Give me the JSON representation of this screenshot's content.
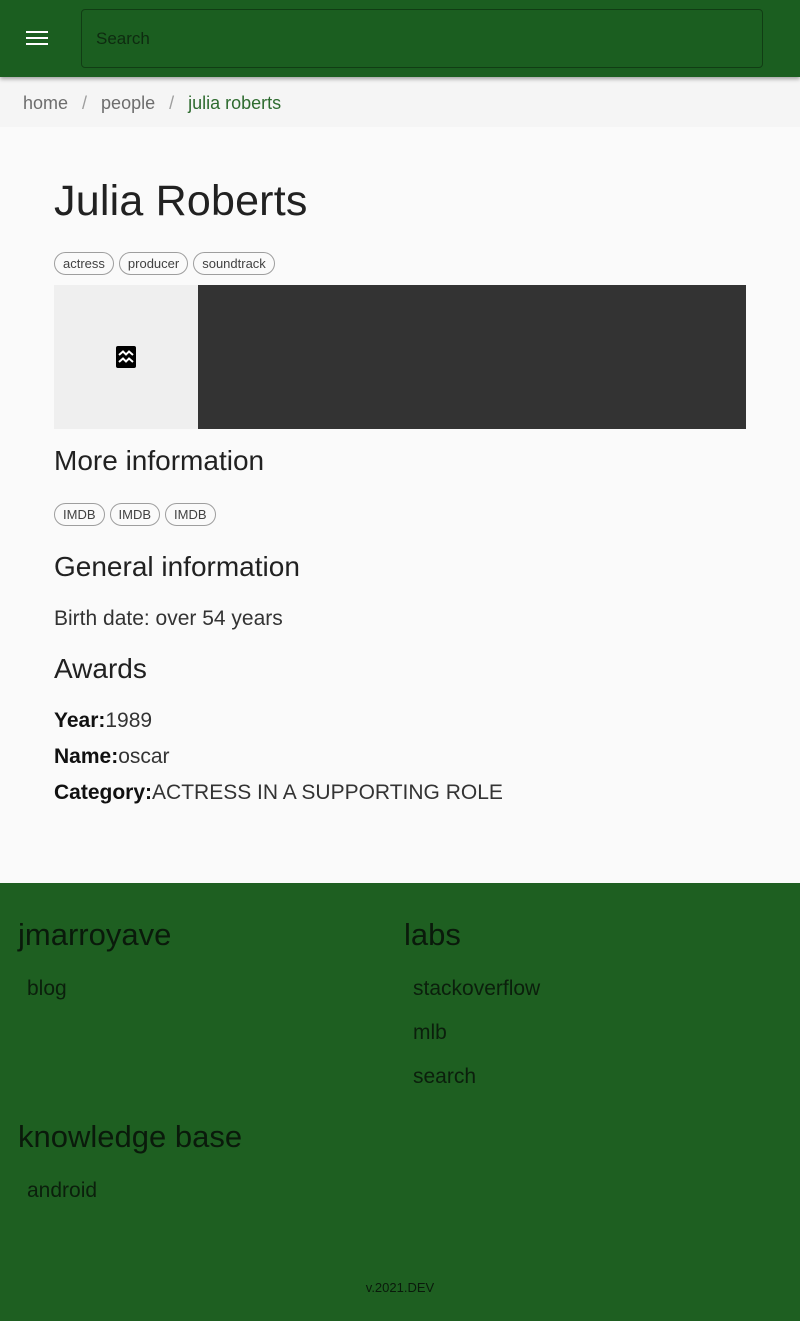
{
  "header": {
    "search_placeholder": "Search"
  },
  "breadcrumb": {
    "items": [
      "home",
      "people",
      "julia roberts"
    ],
    "separator": "/"
  },
  "person": {
    "name": "Julia Roberts",
    "roles": [
      "actress",
      "producer",
      "soundtrack"
    ]
  },
  "more_info": {
    "title": "More information",
    "links": [
      "IMDB",
      "IMDB",
      "IMDB"
    ]
  },
  "general_info": {
    "title": "General information",
    "birth_date": "Birth date: over 54 years"
  },
  "awards": {
    "title": "Awards",
    "year_label": "Year:",
    "year_value": "1989",
    "name_label": "Name:",
    "name_value": "oscar",
    "category_label": "Category:",
    "category_value": "ACTRESS IN A SUPPORTING ROLE"
  },
  "footer": {
    "col1_title": "jmarroyave",
    "col1_links": [
      "blog"
    ],
    "col2_title": "labs",
    "col2_links": [
      "stackoverflow",
      "mlb",
      "search"
    ],
    "col3_title": "knowledge base",
    "col3_links": [
      "android"
    ],
    "version": "v.2021.DEV"
  },
  "colors": {
    "primary": "#1b5e20",
    "breadcrumb_active": "#2e6b2f",
    "media_bg": "#333333"
  },
  "icons": {
    "menu": "hamburger-menu-icon",
    "image": "broken-image-icon"
  }
}
